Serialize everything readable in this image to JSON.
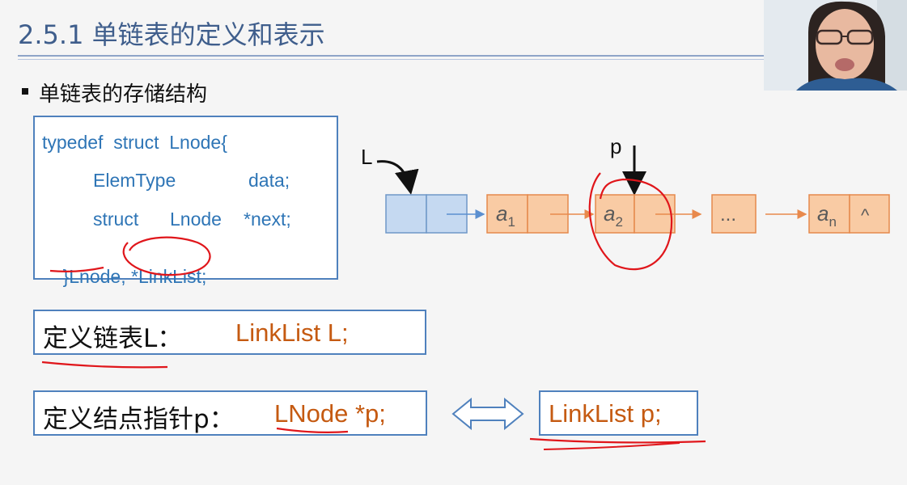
{
  "slide": {
    "title": "2.5.1 单链表的定义和表示",
    "bullet": "单链表的存储结构"
  },
  "code": {
    "line1": "typedef  struct  Lnode{",
    "line2_type": "ElemType",
    "line2_field": "data;",
    "line3_struct": "struct",
    "line3_type": "Lnode",
    "line3_field": "*next;",
    "line4_brace": "}",
    "line4_name1": "Lnode",
    "line4_comma": ", ",
    "line4_name2": "*LinkList",
    "line4_semi": ";"
  },
  "diagram": {
    "head_label": "L",
    "pointer_label": "p",
    "nodes": [
      {
        "text": "a",
        "sub": "1"
      },
      {
        "text": "a",
        "sub": "2"
      },
      {
        "text": "...",
        "sub": ""
      },
      {
        "text": "a",
        "sub": "n"
      }
    ],
    "null_symbol": "^",
    "colors": {
      "head_fill": "#c5d9f1",
      "head_stroke": "#6f97c8",
      "node_fill": "#f9cba4",
      "node_stroke": "#e5894c",
      "arrow_blue": "#5b8fd0",
      "arrow_orange": "#e8894c",
      "ink_red": "#e0161b"
    }
  },
  "defs": {
    "list_label": "定义链表L：",
    "list_code": "LinkList L;",
    "node_label": "定义结点指针p：",
    "node_code": "LNode *p;",
    "equiv_code": "LinkList p;"
  },
  "webcam": {
    "icon": "presenter-video"
  }
}
